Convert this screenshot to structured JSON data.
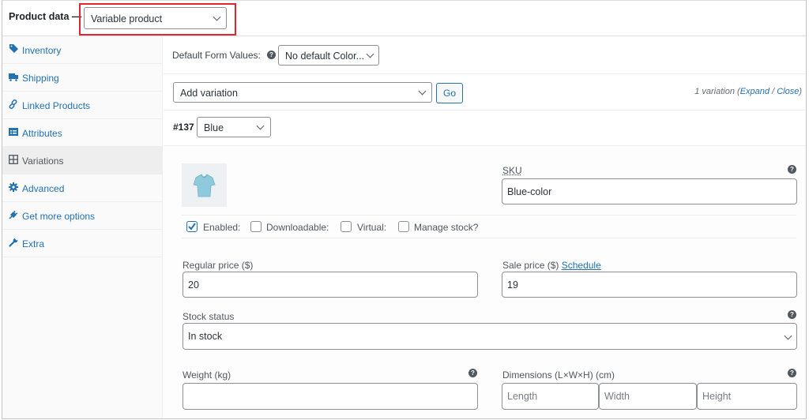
{
  "header": {
    "label": "Product data —",
    "product_type": "Variable product"
  },
  "sidebar": {
    "items": [
      {
        "label": "Inventory",
        "icon": "tag-icon"
      },
      {
        "label": "Shipping",
        "icon": "truck-icon"
      },
      {
        "label": "Linked Products",
        "icon": "link-icon"
      },
      {
        "label": "Attributes",
        "icon": "list-icon"
      },
      {
        "label": "Variations",
        "icon": "grid-icon",
        "active": true
      },
      {
        "label": "Advanced",
        "icon": "gear-icon"
      },
      {
        "label": "Get more options",
        "icon": "plugin-icon"
      },
      {
        "label": "Extra",
        "icon": "wrench-icon"
      }
    ]
  },
  "main": {
    "default_form_values_label": "Default Form Values:",
    "default_color_select": "No default Color...",
    "add_variation_select": "Add variation",
    "go_button": "Go",
    "variation_count": "1 variation",
    "expand_link": "Expand",
    "close_link": "Close",
    "variation": {
      "id": "#137",
      "color": "Blue",
      "sku_label": "SKU",
      "sku_value": "Blue-color",
      "checkboxes": [
        {
          "label": "Enabled:",
          "checked": true
        },
        {
          "label": "Downloadable:",
          "checked": false
        },
        {
          "label": "Virtual:",
          "checked": false
        },
        {
          "label": "Manage stock?",
          "checked": false
        }
      ],
      "regular_price_label": "Regular price ($)",
      "regular_price_value": "20",
      "sale_price_label": "Sale price ($)",
      "schedule_link": "Schedule",
      "sale_price_value": "19",
      "stock_status_label": "Stock status",
      "stock_status_value": "In stock",
      "weight_label": "Weight (kg)",
      "weight_value": "",
      "dimensions_label": "Dimensions (L×W×H) (cm)",
      "length_placeholder": "Length",
      "width_placeholder": "Width",
      "height_placeholder": "Height"
    }
  },
  "colors": {
    "link": "#2271b1",
    "highlight": "#e3262e"
  }
}
